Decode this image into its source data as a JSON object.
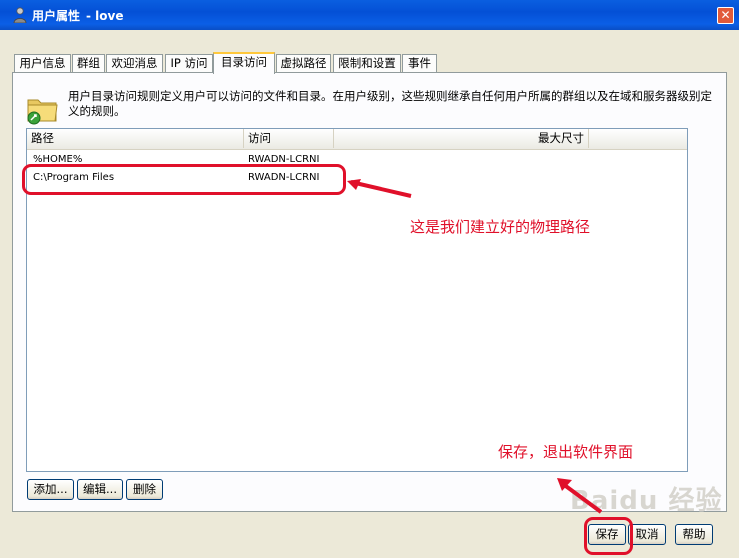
{
  "window": {
    "title": "用户属性",
    "subtitle": "- love",
    "close_label": "✕"
  },
  "tabs": [
    {
      "label": "用户信息"
    },
    {
      "label": "群组"
    },
    {
      "label": "欢迎消息"
    },
    {
      "label": "IP 访问"
    },
    {
      "label": "目录访问",
      "active": true
    },
    {
      "label": "虚拟路径"
    },
    {
      "label": "限制和设置"
    },
    {
      "label": "事件"
    }
  ],
  "description": "用户目录访问规则定义用户可以访问的文件和目录。在用户级别，这些规则继承自任何用户所属的群组以及在域和服务器级别定义的规则。",
  "list": {
    "columns": [
      "路径",
      "访问",
      "最大尺寸"
    ],
    "rows": [
      {
        "path": "%HOME%",
        "access": "RWADN-LCRNI",
        "max_size": ""
      },
      {
        "path": "C:\\Program Files",
        "access": "RWADN-LCRNI",
        "max_size": ""
      }
    ]
  },
  "list_buttons": {
    "add": "添加...",
    "edit": "编辑...",
    "delete": "删除"
  },
  "dialog_buttons": {
    "save": "保存",
    "cancel": "取消",
    "help": "帮助"
  },
  "annotations": {
    "path_note": "这是我们建立好的物理路径",
    "save_note": "保存，退出软件界面"
  },
  "watermark": "Baidu 经验",
  "colors": {
    "titlebar": "#0a5fe0",
    "annotation": "#e0102a",
    "tab_active_accent": "#ffc83c"
  },
  "icons": {
    "title": "user-icon",
    "folder": "folder-icon",
    "close": "close-icon"
  }
}
